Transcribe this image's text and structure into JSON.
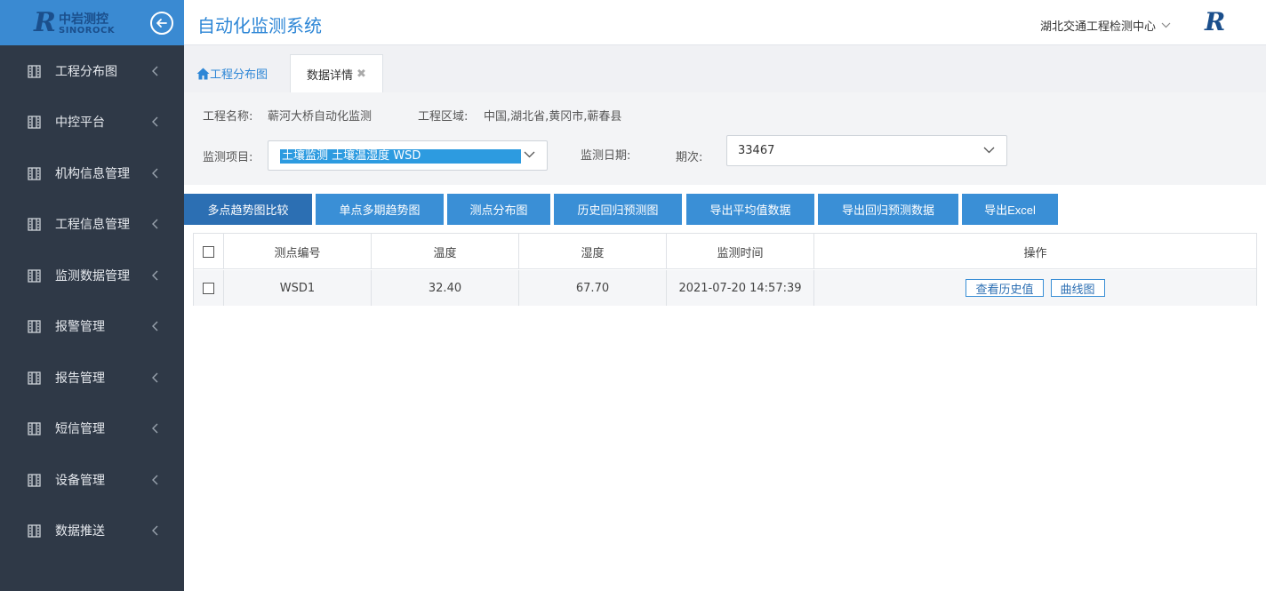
{
  "brand": {
    "logo_cn": "中岩测控",
    "logo_en": "SINOROCK",
    "logo_mark": "R"
  },
  "header": {
    "title": "自动化监测系统",
    "org": "湖北交通工程检测中心"
  },
  "sidebar": {
    "items": [
      {
        "label": "工程分布图"
      },
      {
        "label": "中控平台"
      },
      {
        "label": "机构信息管理"
      },
      {
        "label": "工程信息管理"
      },
      {
        "label": "监测数据管理"
      },
      {
        "label": "报警管理"
      },
      {
        "label": "报告管理"
      },
      {
        "label": "短信管理"
      },
      {
        "label": "设备管理"
      },
      {
        "label": "数据推送"
      }
    ]
  },
  "tabs": {
    "home": "工程分布图",
    "detail": "数据详情"
  },
  "filters": {
    "project_name_label": "工程名称:",
    "project_name_value": "蕲河大桥自动化监测",
    "project_area_label": "工程区域:",
    "project_area_value": "中国,湖北省,黄冈市,蕲春县",
    "monitor_item_label": "监测项目:",
    "monitor_item_value": "土壤监测  土壤温湿度  WSD",
    "monitor_date_label": "监测日期:",
    "period_label": "期次:",
    "period_value": "33467"
  },
  "actions": {
    "multi_trend": "多点趋势图比较",
    "single_trend": "单点多期趋势图",
    "point_dist": "测点分布图",
    "history_reg": "历史回归预测图",
    "export_avg": "导出平均值数据",
    "export_reg": "导出回归预测数据",
    "export_excel": "导出Excel"
  },
  "table": {
    "headers": {
      "point_id": "测点编号",
      "temperature": "温度",
      "humidity": "湿度",
      "time": "监测时间",
      "ops": "操作"
    },
    "rows": [
      {
        "point_id": "WSD1",
        "temperature": "32.40",
        "humidity": "67.70",
        "time": "2021-07-20 14:57:39",
        "op_history": "查看历史值",
        "op_curve": "曲线图"
      }
    ]
  },
  "colors": {
    "sidebar_bg": "#2f3947",
    "brand_blue": "#3a8ad2",
    "button_blue": "#3a8fd6",
    "button_active": "#2c6fb3"
  }
}
